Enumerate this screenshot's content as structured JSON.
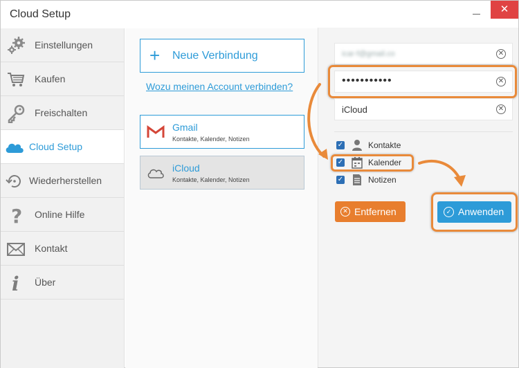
{
  "window": {
    "title": "Cloud Setup",
    "minimize": "",
    "close": "✕"
  },
  "sidebar": {
    "items": [
      {
        "label": "Einstellungen",
        "icon": "gears-icon"
      },
      {
        "label": "Kaufen",
        "icon": "cart-icon"
      },
      {
        "label": "Freischalten",
        "icon": "key-icon"
      },
      {
        "label": "Cloud Setup",
        "icon": "cloud-icon",
        "active": true
      },
      {
        "label": "Wiederherstellen",
        "icon": "restore-icon"
      },
      {
        "label": "Online Hilfe",
        "icon": "question-icon"
      },
      {
        "label": "Kontakt",
        "icon": "envelope-icon"
      },
      {
        "label": "Über",
        "icon": "info-icon"
      }
    ]
  },
  "middle": {
    "new_connection": "Neue Verbindung",
    "why_link": "Wozu meinen Account verbinden?",
    "accounts": [
      {
        "name": "Gmail",
        "services": "Kontakte, Kalender, Notizen",
        "icon": "gmail-icon"
      },
      {
        "name": "iCloud",
        "services": "Kontakte, Kalender, Notizen",
        "icon": "cloud-outline-icon",
        "selected": true
      }
    ]
  },
  "right": {
    "email_value": "icar-f@gmail.co",
    "password_value": "•••••••••••",
    "account_name_value": "iCloud",
    "checkboxes": [
      {
        "label": "Kontakte",
        "checked": true,
        "icon": "person-icon"
      },
      {
        "label": "Kalender",
        "checked": true,
        "icon": "calendar-icon"
      },
      {
        "label": "Notizen",
        "checked": true,
        "icon": "note-icon"
      }
    ],
    "remove_button": "Entfernen",
    "apply_button": "Anwenden"
  },
  "colors": {
    "accent": "#2d9bd8",
    "highlight": "#e98a3a",
    "remove": "#e87e2e",
    "close": "#e04343"
  }
}
